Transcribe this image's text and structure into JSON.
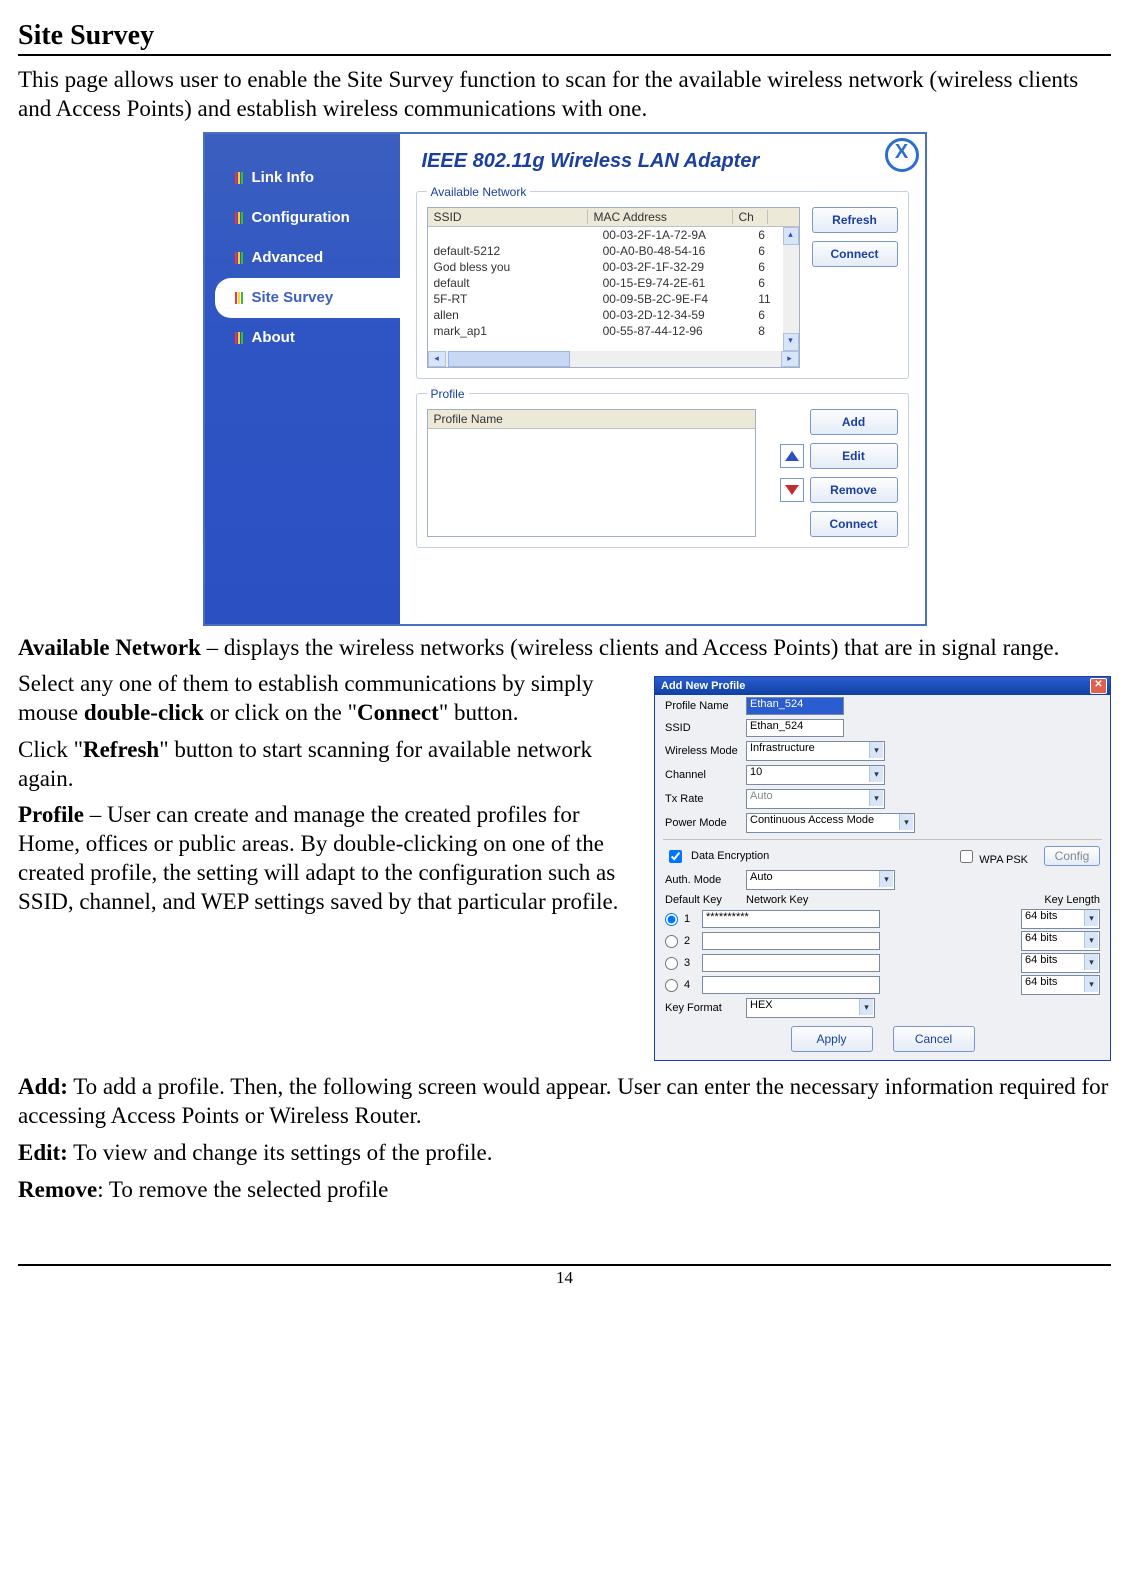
{
  "page": {
    "heading": "Site Survey",
    "intro": "This page allows user to enable the Site Survey function to scan for the available wireless network (wireless clients and Access Points) and establish wireless communications with one.",
    "p_avail": "Available Network – displays the wireless networks (wireless clients and Access Points) that are in signal range.",
    "p_select": "Select any one of them to establish communications by simply mouse double-click or click on the \"Connect\" button.",
    "p_refresh": "Click \"Refresh\" button to start scanning for available network again.",
    "p_profile": "Profile – User can create and manage the created profiles for Home, offices or public areas. By double-clicking on one of the created profile, the setting will adapt to the configuration such as SSID, channel, and WEP settings saved by that particular profile.",
    "p_add": "Add: To add a profile. Then, the following screen would appear. User can enter the necessary information required for accessing Access Points or Wireless Router.",
    "p_edit": "Edit: To view and change its settings of the profile.",
    "p_remove": "Remove: To remove the selected profile",
    "pagenum": "14"
  },
  "wlan": {
    "title": "IEEE 802.11g Wireless LAN Adapter",
    "sidebar": [
      "Link Info",
      "Configuration",
      "Advanced",
      "Site Survey",
      "About"
    ],
    "close": "X",
    "available_legend": "Available Network",
    "profile_legend": "Profile",
    "cols": {
      "ssid": "SSID",
      "mac": "MAC Address",
      "ch": "Ch"
    },
    "rows": [
      {
        "ssid": "",
        "mac": "00-03-2F-1A-72-9A",
        "ch": "6"
      },
      {
        "ssid": "default-5212",
        "mac": "00-A0-B0-48-54-16",
        "ch": "6"
      },
      {
        "ssid": "God bless you",
        "mac": "00-03-2F-1F-32-29",
        "ch": "6"
      },
      {
        "ssid": "default",
        "mac": "00-15-E9-74-2E-61",
        "ch": "6"
      },
      {
        "ssid": "5F-RT",
        "mac": "00-09-5B-2C-9E-F4",
        "ch": "11"
      },
      {
        "ssid": "allen",
        "mac": "00-03-2D-12-34-59",
        "ch": "6"
      },
      {
        "ssid": "mark_ap1",
        "mac": "00-55-87-44-12-96",
        "ch": "8"
      }
    ],
    "btn_refresh": "Refresh",
    "btn_connect": "Connect",
    "profile_col": "Profile Name",
    "btn_add": "Add",
    "btn_edit": "Edit",
    "btn_remove": "Remove",
    "btn_connect2": "Connect"
  },
  "dlg": {
    "title": "Add New Profile",
    "labels": {
      "profile": "Profile Name",
      "ssid": "SSID",
      "wmode": "Wireless Mode",
      "channel": "Channel",
      "txrate": "Tx Rate",
      "pmode": "Power Mode",
      "dataenc": "Data Encryption",
      "wpapsk": "WPA PSK",
      "config": "Config",
      "auth": "Auth. Mode",
      "defkey": "Default Key",
      "netkey": "Network Key",
      "keylen": "Key Length",
      "keyfmt": "Key Format"
    },
    "values": {
      "profile": "Ethan_524",
      "ssid": "Ethan_524",
      "wmode": "Infrastructure",
      "channel": "10",
      "txrate": "Auto",
      "pmode": "Continuous Access Mode",
      "auth": "Auto",
      "key1": "**********",
      "keylen": "64 bits",
      "keyfmt": "HEX"
    },
    "btn_apply": "Apply",
    "btn_cancel": "Cancel"
  }
}
